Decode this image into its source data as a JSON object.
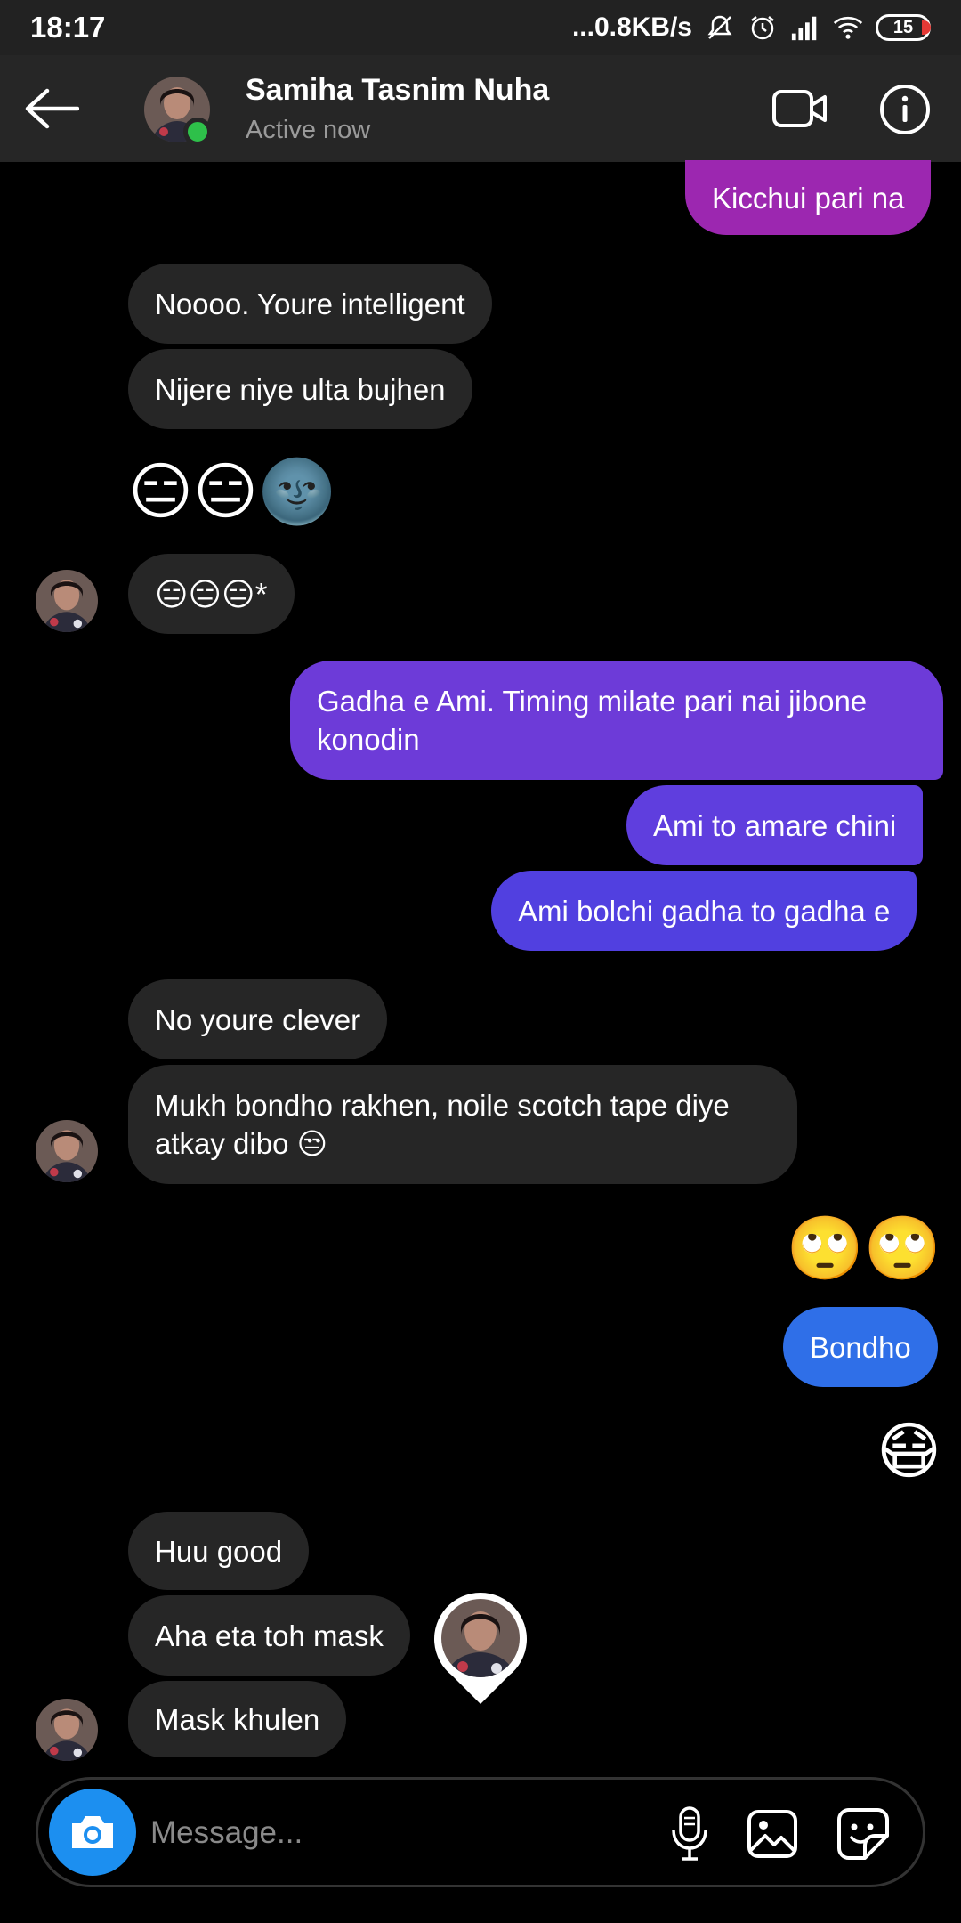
{
  "status_bar": {
    "time": "18:17",
    "network_speed": "...0.8KB/s",
    "battery": "15",
    "icons": [
      "mute-icon",
      "alarm-icon",
      "signal-icon",
      "wifi-icon",
      "battery-icon"
    ]
  },
  "header": {
    "name": "Samiha Tasnim Nuha",
    "status": "Active now",
    "icons": [
      "back-arrow-icon",
      "video-call-icon",
      "info-icon"
    ]
  },
  "messages": {
    "m1": "Kicchui pari na",
    "m2": "Noooo. Youre intelligent",
    "m3": "Nijere niye ulta bujhen",
    "m4_emoji": "😑😑🌚",
    "m5_emoji": "😑😑😑",
    "m5_suffix": "*",
    "m6": "Gadha e Ami. Timing milate pari nai jibone konodin",
    "m7": "Ami to amare chini",
    "m8": "Ami bolchi gadha to gadha e",
    "m9": "No youre clever",
    "m10": "Mukh bondho rakhen, noile scotch tape diye atkay dibo 😒",
    "m11_emoji": "🙄🙄",
    "m12": "Bondho",
    "m13_emoji": "😷",
    "m14": "Huu good",
    "m15": "Aha eta toh mask",
    "m16": "Mask khulen"
  },
  "composer": {
    "placeholder": "Message..."
  },
  "colors": {
    "incoming_bubble": "#262626",
    "out_purple_top": "#9c27b0",
    "out_violet": "#6d3bd8",
    "out_indigo": "#5a3fe0",
    "out_blue": "#2f6fe8",
    "camera_button": "#1c8ff0",
    "online": "#2ec04a"
  }
}
